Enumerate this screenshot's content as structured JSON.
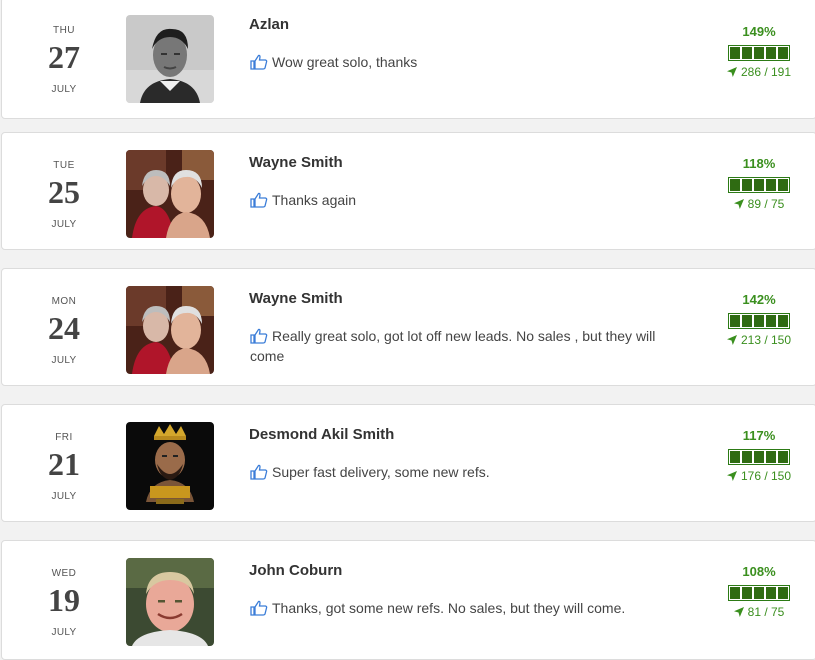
{
  "testimonials": [
    {
      "dow": "THU",
      "day": "27",
      "month": "JULY",
      "name": "Azlan",
      "comment": "Wow great solo, thanks",
      "percent": "149%",
      "clicks": "286 / 191",
      "rating_segments": 5
    },
    {
      "dow": "TUE",
      "day": "25",
      "month": "JULY",
      "name": "Wayne Smith",
      "comment": "Thanks again",
      "percent": "118%",
      "clicks": "89 / 75",
      "rating_segments": 5
    },
    {
      "dow": "MON",
      "day": "24",
      "month": "JULY",
      "name": "Wayne Smith",
      "comment": "Really great solo, got lot off new leads. No sales , but they will come",
      "percent": "142%",
      "clicks": "213 / 150",
      "rating_segments": 5
    },
    {
      "dow": "FRI",
      "day": "21",
      "month": "JULY",
      "name": "Desmond Akil Smith",
      "comment": "Super fast delivery, some new refs.",
      "percent": "117%",
      "clicks": "176 / 150",
      "rating_segments": 5
    },
    {
      "dow": "WED",
      "day": "19",
      "month": "JULY",
      "name": "John Coburn",
      "comment": "Thanks, got some new refs. No sales, but they will come.",
      "percent": "108%",
      "clicks": "81 / 75",
      "rating_segments": 5
    }
  ],
  "colors": {
    "accent_green": "#3a8f1e",
    "bar_fill": "#2f6b12",
    "thumb_blue": "#3b7dd8"
  },
  "icons": {
    "like": "thumbs-up-icon",
    "clicks": "location-arrow-icon"
  }
}
